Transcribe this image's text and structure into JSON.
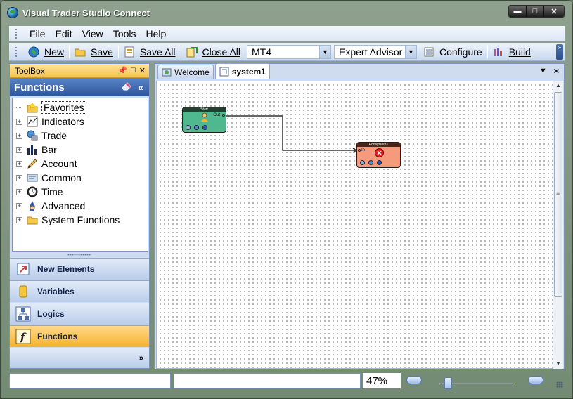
{
  "window": {
    "title": "Visual Trader Studio Connect",
    "minimize": "▬",
    "maximize": "□",
    "close": "✕"
  },
  "menu": [
    "File",
    "Edit",
    "View",
    "Tools",
    "Help"
  ],
  "toolbar": {
    "new": "New",
    "save": "Save",
    "save_all": "Save All",
    "close_all": "Close All",
    "platform": "MT4",
    "program_type": "Expert Advisor",
    "configure": "Configure",
    "build": "Build"
  },
  "toolbox": {
    "title": "ToolBox",
    "section_title": "Functions",
    "tree": [
      {
        "label": "Favorites",
        "icon": "star-folder-icon",
        "expandable": false,
        "selected": true
      },
      {
        "label": "Indicators",
        "icon": "chart-icon",
        "expandable": true
      },
      {
        "label": "Trade",
        "icon": "trade-icon",
        "expandable": true
      },
      {
        "label": "Bar",
        "icon": "bar-chart-icon",
        "expandable": true
      },
      {
        "label": "Account",
        "icon": "pencil-icon",
        "expandable": true
      },
      {
        "label": "Common",
        "icon": "common-icon",
        "expandable": true
      },
      {
        "label": "Time",
        "icon": "clock-icon",
        "expandable": true
      },
      {
        "label": "Advanced",
        "icon": "wizard-icon",
        "expandable": true
      },
      {
        "label": "System Functions",
        "icon": "folder-icon",
        "expandable": true
      }
    ],
    "nav": [
      {
        "label": "New Elements",
        "icon": "new-elements-icon",
        "active": false
      },
      {
        "label": "Variables",
        "icon": "variables-icon",
        "active": false
      },
      {
        "label": "Logics",
        "icon": "logics-icon",
        "active": false
      },
      {
        "label": "Functions",
        "icon": "functions-icon",
        "active": true
      }
    ]
  },
  "tabs": [
    {
      "label": "Welcome",
      "active": false
    },
    {
      "label": "system1",
      "active": true
    }
  ],
  "diagram": {
    "start_node": {
      "title": "Start",
      "port": "Out"
    },
    "end_node": {
      "title": "Endsystem1",
      "port": "In"
    }
  },
  "status": {
    "zoom": "47%"
  },
  "colors": {
    "accent": "#2c559b",
    "active": "#f6b12f",
    "start_node": "#4fb88e",
    "end_node": "#f69a7e"
  }
}
